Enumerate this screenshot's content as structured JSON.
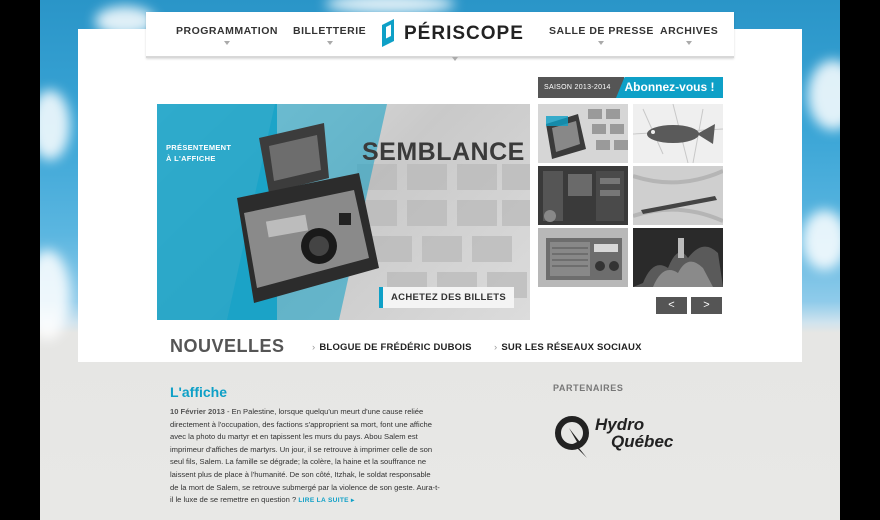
{
  "nav": {
    "programmation": "PROGRAMMATION",
    "billetterie": "BILLETTERIE",
    "logo_text": "PÉRISCOPE",
    "presse": "SALLE DE PRESSE",
    "archives": "ARCHIVES"
  },
  "hero": {
    "subtitle_line1": "PRÉSENTEMENT",
    "subtitle_line2": "À L'AFFICHE",
    "title": "SEMBLANCE",
    "buy_label": "ACHETEZ DES BILLETS"
  },
  "season": {
    "label": "SAISON 2013-2014",
    "cta": "Abonnez-vous !"
  },
  "gallery": {
    "thumbs": [
      "camera-photo",
      "fish-photo",
      "interior-photo",
      "bat-photo",
      "radio-photo",
      "smoke-photo"
    ],
    "prev": "<",
    "next": ">"
  },
  "news": {
    "heading": "NOUVELLES",
    "link_blog": "BLOGUE DE FRÉDÉRIC DUBOIS",
    "link_social": "SUR LES RÉSEAUX SOCIAUX"
  },
  "article": {
    "title": "L'affiche",
    "date": "10 Février 2013",
    "body": " - En Palestine, lorsque quelqu'un meurt d'une cause reliée directement à l'occupation, des factions s'approprient sa mort, font une affiche avec la photo du martyr et en tapissent les murs du pays. Abou Salem est imprimeur d'affiches de martyrs. Un jour, il se retrouve à imprimer celle de son seul fils, Salem. La famille se dégrade; la colère, la haine et la souffrance ne laissent plus de place à l'humanité. De son côté, Itzhak, le soldat responsable de la mort de Salem, se retrouve submergé par la violence de son geste. Aura-t-il le luxe de se remettre en question ? ",
    "more": "LIRE LA SUITE ▸"
  },
  "partners": {
    "label": "PARTENAIRES",
    "hydro_line1": "Hydro",
    "hydro_line2": "Québec"
  },
  "colors": {
    "accent": "#0ea0c7",
    "dark": "#555555"
  }
}
